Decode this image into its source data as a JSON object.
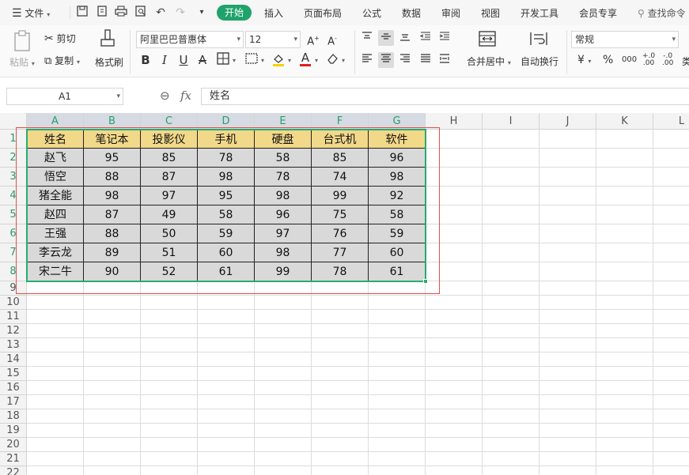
{
  "menu": {
    "file_label": "文件",
    "tabs": [
      "开始",
      "插入",
      "页面布局",
      "公式",
      "数据",
      "审阅",
      "视图",
      "开发工具",
      "会员专享"
    ],
    "search_label": "查找命令"
  },
  "ribbon": {
    "paste_label": "粘贴",
    "cut_label": "剪切",
    "copy_label": "复制",
    "format_painter_label": "格式刷",
    "font_name": "阿里巴巴普惠体",
    "font_size": "12",
    "merge_label": "合并居中",
    "wrap_label": "自动换行",
    "number_format": "常规",
    "currency_symbol": "¥",
    "percent_symbol": "%",
    "thousands_symbol": "000",
    "increase_decimal_label": "+.0",
    "decrease_decimal_label": "-.0",
    "cut_off_label": "类"
  },
  "formula_bar": {
    "cell_ref": "A1",
    "fx_label": "fx",
    "content": "姓名"
  },
  "sheet": {
    "columns": [
      "A",
      "B",
      "C",
      "D",
      "E",
      "F",
      "G",
      "H",
      "I",
      "J",
      "K",
      "L"
    ],
    "rows": [
      "1",
      "2",
      "3",
      "4",
      "5",
      "6",
      "7",
      "8",
      "9",
      "10",
      "11",
      "12",
      "13",
      "14",
      "15",
      "16",
      "17",
      "18",
      "19",
      "20",
      "21",
      "22"
    ],
    "table_headers": [
      "姓名",
      "笔记本",
      "投影仪",
      "手机",
      "硬盘",
      "台式机",
      "软件"
    ],
    "table_rows": [
      [
        "赵飞",
        "95",
        "85",
        "78",
        "58",
        "85",
        "96"
      ],
      [
        "悟空",
        "88",
        "87",
        "98",
        "78",
        "74",
        "98"
      ],
      [
        "猪全能",
        "98",
        "97",
        "95",
        "98",
        "99",
        "92"
      ],
      [
        "赵四",
        "87",
        "49",
        "58",
        "96",
        "75",
        "58"
      ],
      [
        "王强",
        "88",
        "50",
        "59",
        "97",
        "76",
        "59"
      ],
      [
        "李云龙",
        "89",
        "51",
        "60",
        "98",
        "77",
        "60"
      ],
      [
        "宋二牛",
        "90",
        "52",
        "61",
        "99",
        "78",
        "61"
      ]
    ]
  },
  "colors": {
    "accent_green": "#1fa36a",
    "header_fill": "#f2d889",
    "body_fill": "#d9d9d9",
    "selection_border": "#2aaa72",
    "annotation_border": "#e0504e"
  }
}
